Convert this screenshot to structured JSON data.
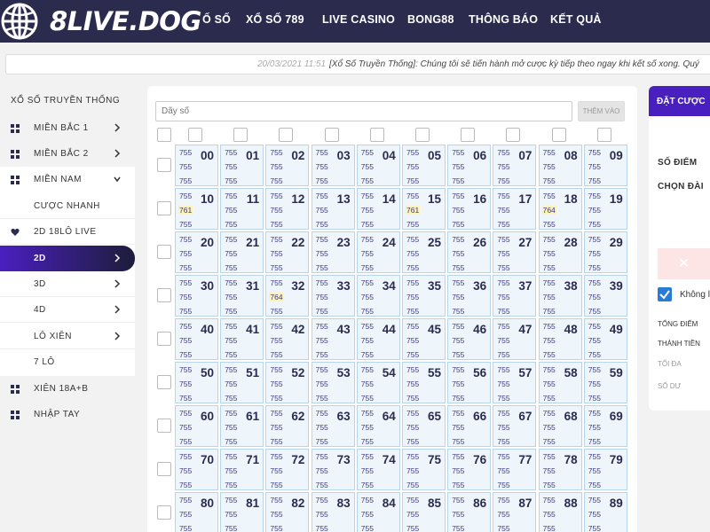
{
  "header": {
    "logo_text": "8LIVE.DOG",
    "nav": [
      {
        "label": "Ố SỐ"
      },
      {
        "label": "XỔ SỐ 789"
      },
      {
        "label": "LIVE CASINO"
      },
      {
        "label": "BONG88"
      },
      {
        "label": "THÔNG BÁO"
      },
      {
        "label": "KẾT QUẢ"
      }
    ]
  },
  "ticker": {
    "date": "20/03/2021 11:51",
    "text": "[Xổ Số Truyền Thống]: Chúng tôi sẽ tiến hành mở cược kỳ tiếp theo ngay khi kết số xong. Quý"
  },
  "sidebar": {
    "title": "XỔ SỐ TRUYỀN THỐNG",
    "items": [
      {
        "label": "MIỀN BẮC 1",
        "icon": "grid-icon",
        "chevron": "chevron-right-icon"
      },
      {
        "label": "MIỀN BẮC 2",
        "icon": "grid-icon",
        "chevron": "chevron-right-icon"
      },
      {
        "label": "MIỀN NAM",
        "icon": "grid-icon",
        "chevron": "chevron-down-icon"
      },
      {
        "label": "CƯỢC NHANH"
      },
      {
        "label": "2D 18LÔ LIVE",
        "icon": "heart-icon"
      },
      {
        "label": "2D",
        "chevron": "chevron-right-icon",
        "active": true
      },
      {
        "label": "3D",
        "chevron": "chevron-right-icon"
      },
      {
        "label": "4D",
        "chevron": "chevron-right-icon"
      },
      {
        "label": "LÔ XIÊN",
        "chevron": "chevron-right-icon"
      },
      {
        "label": "7 LÔ"
      },
      {
        "label": "XIÊN 18A+B",
        "icon": "grid-icon"
      },
      {
        "label": "NHẬP TAY",
        "icon": "grid-icon"
      }
    ]
  },
  "main": {
    "input_placeholder": "Dãy số",
    "add_button": "THÊM VÀO",
    "default_value": "755",
    "highlights": {
      "10": [
        "755",
        "761",
        "755"
      ],
      "15": [
        "755",
        "761",
        "755"
      ],
      "18": [
        "755",
        "764",
        "755"
      ],
      "32": [
        "755",
        "764",
        "755"
      ]
    },
    "highlight_color": "#fdf3b8"
  },
  "right_panel": {
    "title": "ĐẶT CƯỢC",
    "so_diem": "SỐ ĐIỂM",
    "chon_dai": "CHỌN ĐÀI",
    "checkbox_label": "Không l",
    "tong_diem": "TỔNG ĐIỂM",
    "thanh_tien": "THÀNH TIỀN",
    "toi_da": "TỐI ĐA",
    "so_du": "SỐ DƯ"
  },
  "colors": {
    "header_bg": "#2b2b4e",
    "accent": "#4a1fc0",
    "cell_bg": "#eef6fc",
    "cell_border": "#b8d4ea"
  }
}
